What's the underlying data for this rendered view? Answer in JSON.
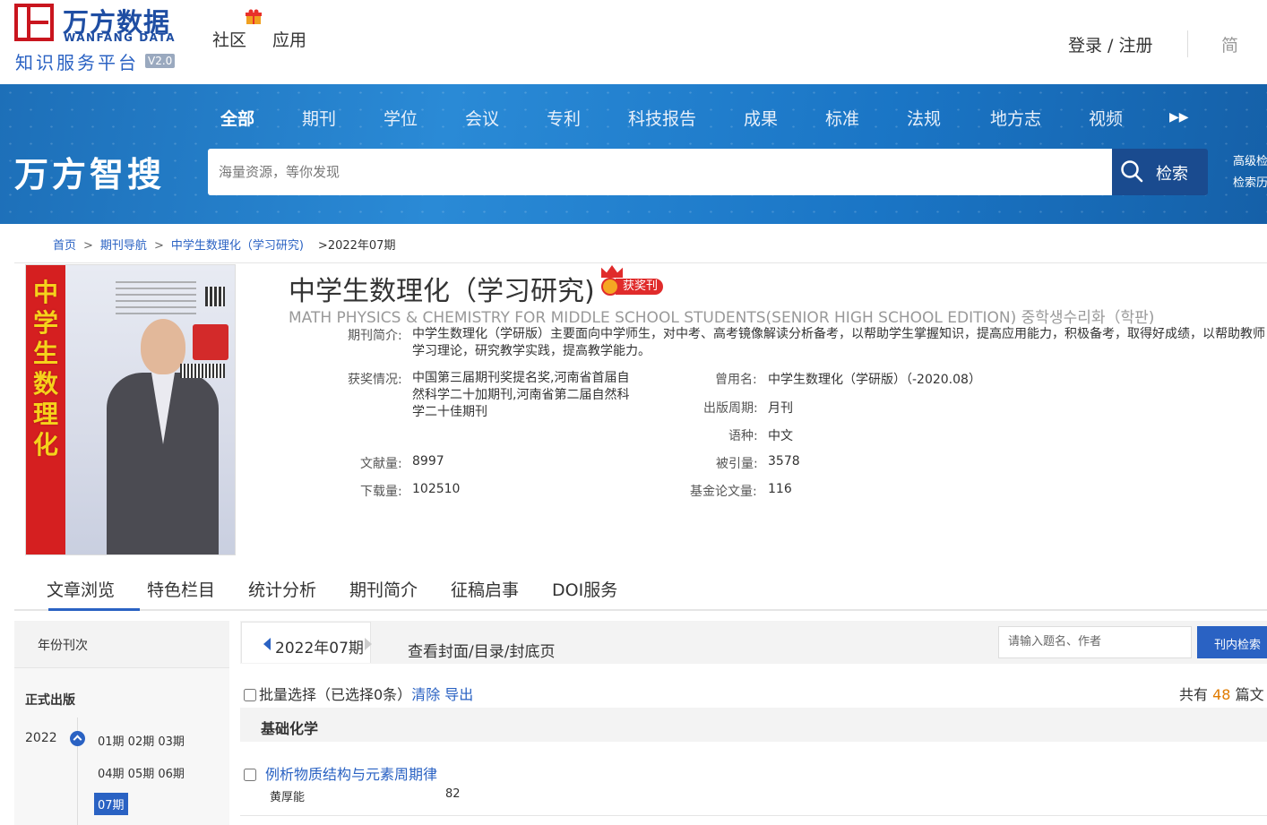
{
  "header": {
    "logo_cn": "万方数据",
    "logo_en": "WANFANG DATA",
    "logo_sub": "知识服务平台",
    "logo_version": "V2.0",
    "nav": [
      "社区",
      "应用"
    ],
    "login_label": "登录 / 注册",
    "lang_label": "简"
  },
  "banner": {
    "title": "万方智搜",
    "categories": [
      "全部",
      "期刊",
      "学位",
      "会议",
      "专利",
      "科技报告",
      "成果",
      "标准",
      "法规",
      "地方志",
      "视频"
    ],
    "active_category": "全部",
    "search_placeholder": "海量资源，等你发现",
    "search_button": "检索",
    "advanced_search": "高级检",
    "search_history": "检索历"
  },
  "breadcrumb": {
    "home": "首页",
    "journal_nav": "期刊导航",
    "journal": "中学生数理化（学习研究)",
    "current": ">2022年07期"
  },
  "journal": {
    "title": "中学生数理化（学习研究)",
    "award_badge": "获奖刊",
    "title_en": "MATH PHYSICS & CHEMISTRY FOR MIDDLE SCHOOL STUDENTS(SENIOR HIGH SCHOOL EDITION) 중학생수리화（학판)",
    "intro_label": "期刊简介:",
    "intro": "中学生数理化（学研版）主要面向中学师生，对中考、高考镜像解读分析备考，以帮助学生掌握知识，提高应用能力，积极备考，取得好成绩，以帮助教师学习理论，研究教学实践，提高教学能力。",
    "award_label": "获奖情况:",
    "award": "中国第三届期刊奖提名奖,河南省首届自然科学二十加期刊,河南省第二届自然科学二十佳期刊",
    "former_name_label": "曾用名:",
    "former_name": "中学生数理化（学研版）（-2020.08）",
    "frequency_label": "出版周期:",
    "frequency": "月刊",
    "language_label": "语种:",
    "language": "中文",
    "docs_label": "文献量:",
    "docs": "8997",
    "cited_label": "被引量:",
    "cited": "3578",
    "downloads_label": "下载量:",
    "downloads": "102510",
    "fund_label": "基金论文量:",
    "fund": "116"
  },
  "tabs": [
    "文章浏览",
    "特色栏目",
    "统计分析",
    "期刊简介",
    "征稿启事",
    "DOI服务"
  ],
  "left_panel": {
    "heading": "年份刊次",
    "section": "正式出版",
    "year": "2022",
    "issues_row1": "01期  02期  03期",
    "issues_row2": "04期  05期  06期",
    "active_issue": "07期"
  },
  "right_panel": {
    "current_issue": "2022年07期",
    "cover_link": "查看封面/目录/封底页",
    "inner_search_placeholder": "请输入题名、作者",
    "inner_search_button": "刊内检索",
    "batch_label": "批量选择（已选择0条）",
    "clear_label": "清除",
    "export_label": "导出",
    "total_prefix": "共有",
    "total_count": "48",
    "total_suffix": "篇文",
    "section_title": "基础化学",
    "article_title": "例析物质结构与元素周期律",
    "article_author": "黄厚能",
    "article_page": "82"
  },
  "colors": {
    "brand_red": "#c9151e",
    "brand_blue": "#1f4ea3",
    "link_blue": "#2a62c3",
    "count_orange": "#e07b00"
  }
}
